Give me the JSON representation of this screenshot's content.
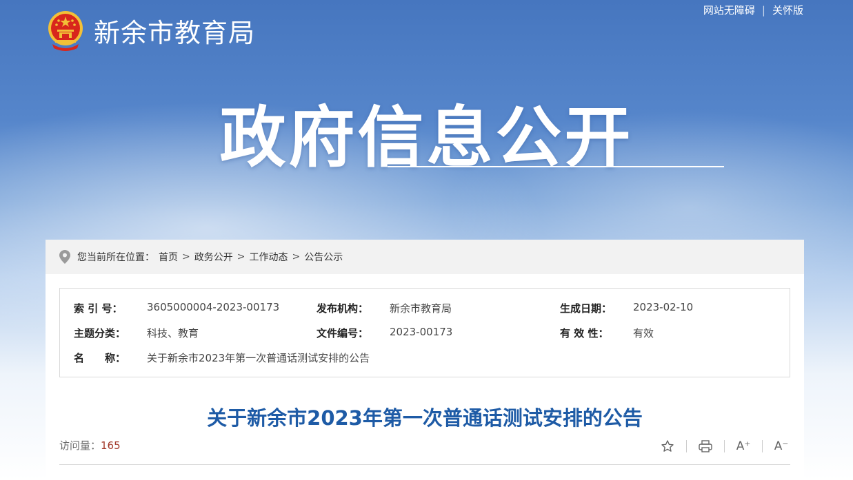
{
  "topbar": {
    "accessibility": "网站无障碍",
    "separator": "|",
    "care_mode": "关怀版"
  },
  "site": {
    "name": "新余市教育局"
  },
  "banner": {
    "title": "政府信息公开"
  },
  "breadcrumb": {
    "prefix": "您当前所在位置：",
    "items": [
      "首页",
      "政务公开",
      "工作动态",
      "公告公示"
    ],
    "arrow": ">"
  },
  "meta": {
    "index_label": "索 引 号：",
    "index_value": "3605000004-2023-00173",
    "publisher_label": "发布机构：",
    "publisher_value": "新余市教育局",
    "date_label": "生成日期：",
    "date_value": "2023-02-10",
    "topic_label": "主题分类：",
    "topic_value": "科技、教育",
    "docno_label": "文件编号：",
    "docno_value": "2023-00173",
    "validity_label": "有 效 性：",
    "validity_value": "有效",
    "name_label": "名　　称：",
    "name_value": "关于新余市2023年第一次普通话测试安排的公告"
  },
  "document": {
    "title": "关于新余市2023年第一次普通话测试安排的公告"
  },
  "visits": {
    "label": "访问量：",
    "count": "165"
  },
  "tools": {
    "font_up": "A⁺",
    "font_down": "A⁻"
  },
  "colors": {
    "title_blue": "#1e5ba6",
    "visit_red": "#a33a2b",
    "emblem_red": "#d8261c",
    "emblem_gold": "#f2c037"
  }
}
